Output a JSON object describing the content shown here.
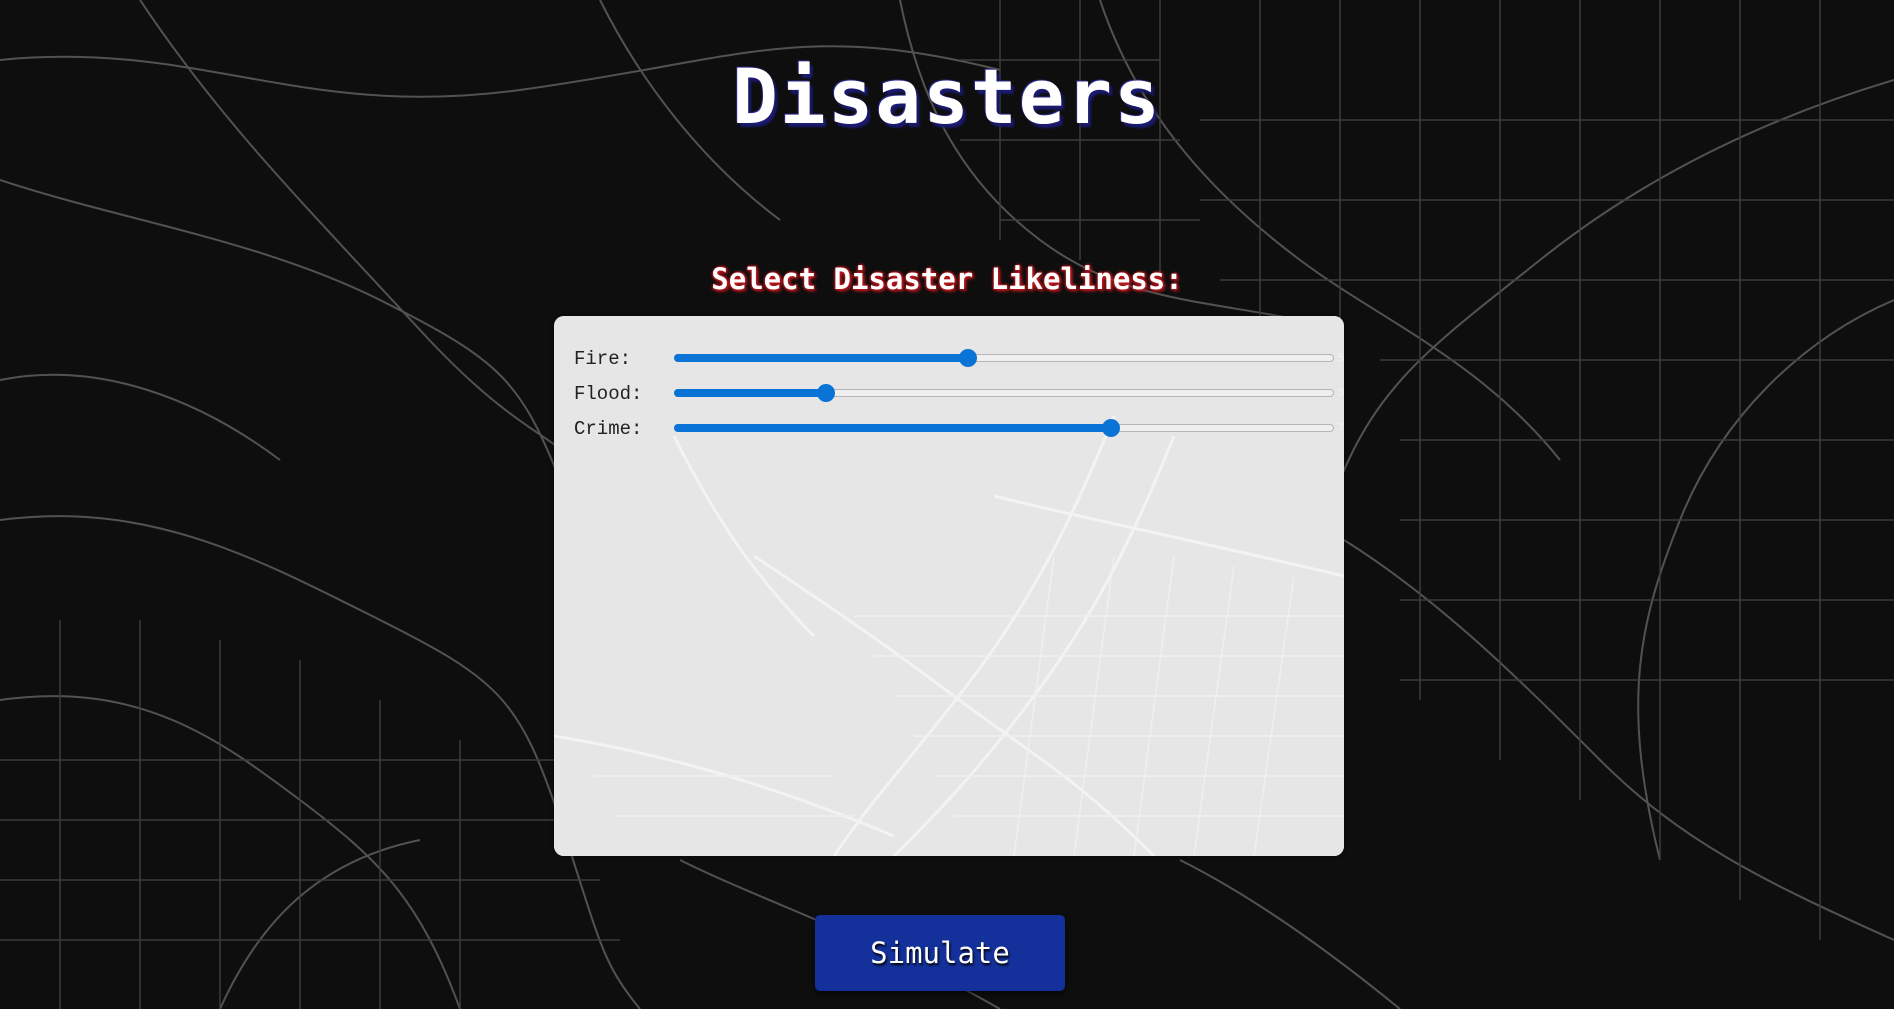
{
  "page": {
    "title": "Disasters",
    "subtitle": "Select Disaster Likeliness:"
  },
  "sliders": [
    {
      "label": "Fire:",
      "value": 5,
      "min": 1,
      "max": 10
    },
    {
      "label": "Flood:",
      "value": 3,
      "min": 1,
      "max": 10
    },
    {
      "label": "Crime:",
      "value": 7,
      "min": 1,
      "max": 10
    }
  ],
  "actions": {
    "simulate_label": "Simulate"
  },
  "colors": {
    "background": "#0e0e0e",
    "panel": "#e6e6e6",
    "slider_accent": "#0a74d6",
    "button": "#14309a",
    "subtitle_glow": "#c0181e",
    "title_shadow": "#1a1a6e"
  }
}
